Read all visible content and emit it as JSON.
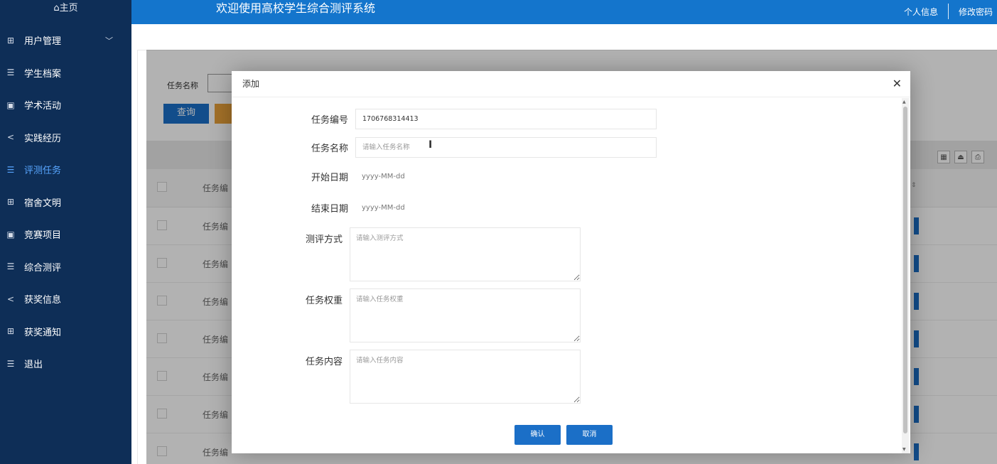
{
  "sidebar": {
    "home": "⌂主页",
    "items": [
      {
        "icon": "grid-icon",
        "label": "用户管理",
        "has_chevron": true
      },
      {
        "icon": "list-icon",
        "label": "学生档案"
      },
      {
        "icon": "book-icon",
        "label": "学术活动"
      },
      {
        "icon": "share-icon",
        "label": "实践经历"
      },
      {
        "icon": "list-icon",
        "label": "评测任务",
        "active": true
      },
      {
        "icon": "grid-icon",
        "label": "宿舍文明"
      },
      {
        "icon": "book-icon",
        "label": "竞赛项目"
      },
      {
        "icon": "list-icon",
        "label": "综合测评"
      },
      {
        "icon": "share-icon",
        "label": "获奖信息"
      },
      {
        "icon": "grid-icon",
        "label": "获奖通知"
      },
      {
        "icon": "list-icon",
        "label": "退出"
      }
    ]
  },
  "header": {
    "title": "欢迎使用高校学生综合测评系统",
    "profile": "个人信息",
    "change_password": "修改密码"
  },
  "background": {
    "search_label": "任务名称",
    "query_button": "查询",
    "column_header": "任务编",
    "row_cell": "任务编"
  },
  "modal": {
    "title": "添加",
    "fields": {
      "task_no_label": "任务编号",
      "task_no_value": "1706768314413",
      "task_name_label": "任务名称",
      "task_name_placeholder": "请输入任务名称",
      "start_label": "开始日期",
      "start_placeholder": "yyyy-MM-dd",
      "end_label": "结束日期",
      "end_placeholder": "yyyy-MM-dd",
      "method_label": "测评方式",
      "method_placeholder": "请输入测评方式",
      "weight_label": "任务权重",
      "weight_placeholder": "请输入任务权重",
      "content_label": "任务内容",
      "content_placeholder": "请输入任务内容"
    },
    "confirm": "确认",
    "cancel": "取消"
  },
  "colors": {
    "sidebar_bg": "#0e2e57",
    "header_bg": "#1475cc",
    "primary_button": "#1b6fc7",
    "active_nav": "#58a6ff"
  }
}
